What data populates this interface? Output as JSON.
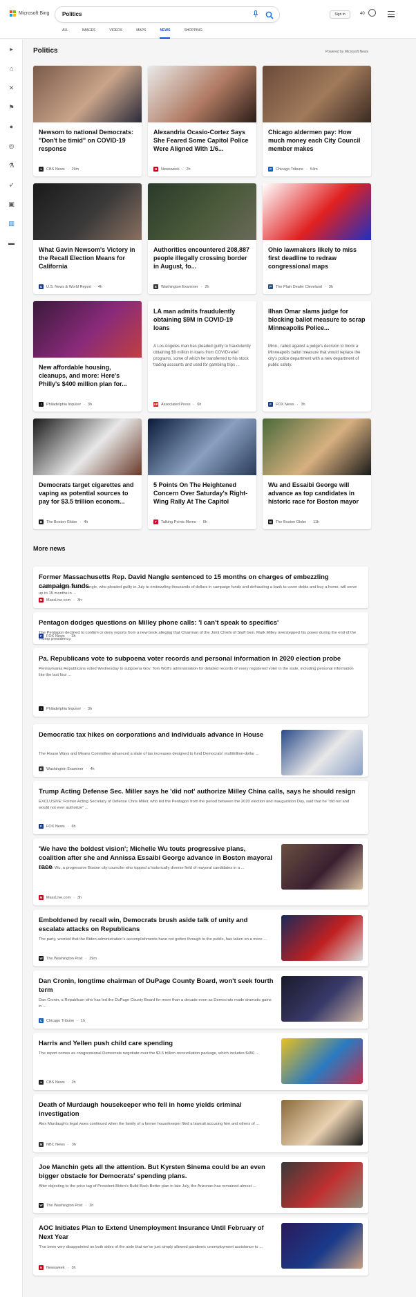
{
  "header": {
    "logo_text": "Microsoft Bing",
    "search_query": "Politics",
    "tabs": [
      "ALL",
      "IMAGES",
      "VIDEOS",
      "MAPS",
      "NEWS",
      "SHOPPING"
    ],
    "active_tab": "NEWS",
    "signin_label": "Sign in",
    "reward_points": "40"
  },
  "rail": {
    "items": [
      "expand-icon",
      "home-icon",
      "tools-icon",
      "flag-icon",
      "location-icon",
      "globe-icon",
      "science-icon",
      "rocket-icon",
      "media-icon",
      "building-icon",
      "card-icon"
    ]
  },
  "section": {
    "title": "Politics",
    "powered_by": "Powered by Microsoft News"
  },
  "cards": [
    {
      "title": "Newsom to national Democrats: \"Don't be timid\" on COVID-19 response",
      "source": "CBS News",
      "time": "29m",
      "logo": "●",
      "logo_color": "#222222",
      "image_colors": [
        "#7a5a4a",
        "#c9a48a",
        "#2b2b3a"
      ]
    },
    {
      "title": "Alexandria Ocasio-Cortez Says She Feared Some Capitol Police Were Aligned With 1/6...",
      "source": "Newsweek",
      "time": "2h",
      "logo": "N",
      "logo_color": "#d0021b",
      "image_colors": [
        "#e9e9e9",
        "#b07a62",
        "#2a1d18"
      ]
    },
    {
      "title": "Chicago aldermen pay: How much money each City Council member makes",
      "source": "Chicago Tribune",
      "time": "54m",
      "logo": "C",
      "logo_color": "#1a5fb4",
      "image_colors": [
        "#6b4a3a",
        "#a07a5a",
        "#3a2a22"
      ]
    },
    {
      "title": "What Gavin Newsom's Victory in the Recall Election Means for California",
      "source": "U.S. News & World Report",
      "time": "4h",
      "logo": "U",
      "logo_color": "#1c3d8f",
      "image_colors": [
        "#1a1a1a",
        "#3a3a3a",
        "#8a7060"
      ]
    },
    {
      "title": "Authorities encountered 208,887 people illegally crossing border in August, fo...",
      "source": "Washington Examiner",
      "time": "2h",
      "logo": "E",
      "logo_color": "#333333",
      "image_colors": [
        "#2a3a2a",
        "#4a5a3a",
        "#6a6a5a"
      ]
    },
    {
      "title": "Ohio lawmakers likely to miss first deadline to redraw congressional maps",
      "source": "The Plain Dealer Cleveland",
      "time": "3h",
      "logo": "P",
      "logo_color": "#2b4c7e",
      "image_colors": [
        "#ffffff",
        "#e02020",
        "#2030c0"
      ]
    },
    {
      "title": "New affordable housing, cleanups, and more: Here's Philly's $400 million plan for...",
      "source": "Philadelphia Inquirer",
      "time": "3h",
      "logo": "I",
      "logo_color": "#111111",
      "image_colors": [
        "#3a1a3a",
        "#8a2a7a",
        "#c04040"
      ]
    },
    {
      "title": "LA man admits fraudulently obtaining $9M in COVID-19 loans",
      "snippet": "A Los Angeles man has pleaded guilty to fraudulently obtaining $9 million in loans from COVID-relief programs, some of which he transferred to his stock trading accounts and used for gambling trips ...",
      "source": "Associated Press",
      "time": "6h",
      "logo": "AP",
      "logo_color": "#e2231a"
    },
    {
      "title": "Ilhan Omar slams judge for blocking ballot measure to scrap Minneapolis Police...",
      "snippet": "Minn., railed against a judge's decision to block a Minneapolis ballot measure that would replace the city's police department with a new department of public safety.",
      "source": "FOX News",
      "time": "3h",
      "logo": "F",
      "logo_color": "#1a3a8a"
    },
    {
      "title": "Democrats target cigarettes and vaping as potential sources to pay for $3.5 trillion econom...",
      "source": "The Boston Globe",
      "time": "4h",
      "logo": "B",
      "logo_color": "#222222",
      "image_colors": [
        "#1a1a1a",
        "#e8e8e8",
        "#6a3a2a"
      ]
    },
    {
      "title": "5 Points On The Heightened Concern Over Saturday's Right-Wing Rally At The Capitol",
      "source": "Talking Points Memo",
      "time": "6h",
      "logo": "T",
      "logo_color": "#c8102e",
      "image_colors": [
        "#0a1a3a",
        "#8aa0c0",
        "#2a3a5a"
      ]
    },
    {
      "title": "Wu and Essaibi George will advance as top candidates in historic race for Boston mayor",
      "source": "The Boston Globe",
      "time": "11h",
      "logo": "B",
      "logo_color": "#222222",
      "image_colors": [
        "#4a6a3a",
        "#d8b080",
        "#1a1a1a"
      ]
    }
  ],
  "more_news": {
    "title": "More news",
    "items": [
      {
        "title": "Former Massachusetts Rep. David Nangle sentenced to 15 months on charges of embezzling campaign funds",
        "snippet": "Former State Rep. David Nangle, who pleaded guilty in July to embezzling thousands of dollars in campaign funds and defrauding a bank to cover debts and buy a home, will serve up to 15 months in ...",
        "source": "MassLive.com",
        "time": "3h",
        "logo": "M",
        "logo_color": "#d0021b"
      },
      {
        "title": "Pentagon dodges questions on Milley phone calls: 'I can't speak to specifics'",
        "snippet": "The Pentagon declined to confirm or deny reports from a new book alleging that Chairman of the Joint Chiefs of Staff Gen. Mark Milley overstepped his power during the end of the Trump presidency.",
        "source": "FOX News",
        "time": "3h",
        "logo": "F",
        "logo_color": "#1a3a8a"
      },
      {
        "title": "Pa. Republicans vote to subpoena voter records and personal information in 2020 election probe",
        "snippet": "Pennsylvania Republicans voted Wednesday to subpoena Gov. Tom Wolf's administration for detailed records of every registered voter in the state, including personal information like the last four ...",
        "source": "Philadelphia Inquirer",
        "time": "3h",
        "logo": "I",
        "logo_color": "#111111"
      },
      {
        "title": "Democratic tax hikes on corporations and individuals advance in House",
        "snippet": "The House Ways and Means Committee advanced a slate of tax increases designed to fund Democrats' multitrillion-dollar ...",
        "source": "Washington Examiner",
        "time": "4h",
        "logo": "E",
        "logo_color": "#333333",
        "image_colors": [
          "#2a4a8a",
          "#e8e8e8",
          "#8aa0c8"
        ]
      },
      {
        "title": "Trump Acting Defense Sec. Miller says he 'did not' authorize Milley China calls, says he should resign",
        "snippet": "EXCLUSIVE: Former Acting Secretary of Defense Chris Miller, who led the Pentagon from the period between the 2020 election and inauguration Day, said that he \"did not and would not ever authorize\" ...",
        "source": "FOX News",
        "time": "6h",
        "logo": "F",
        "logo_color": "#1a3a8a"
      },
      {
        "title": "'We have the boldest vision'; Michelle Wu touts progressive plans, coalition after she and Annissa Essaibi George advance in Boston mayoral race",
        "snippet": "Michelle Wu, a progressive Boston city councilor who topped a historically diverse field of mayoral candidates in a ...",
        "source": "MassLive.com",
        "time": "3h",
        "logo": "M",
        "logo_color": "#d0021b",
        "image_colors": [
          "#6a5040",
          "#3a2030",
          "#d8c0a0"
        ]
      },
      {
        "title": "Emboldened by recall win, Democrats brush aside talk of unity and escalate attacks on Republicans",
        "snippet": "The party, worried that the Biden administration's accomplishments have not gotten through to the public, has taken on a more ...",
        "source": "The Washington Post",
        "time": "29m",
        "logo": "W",
        "logo_color": "#111111",
        "image_colors": [
          "#1a2a5a",
          "#c02020",
          "#d8d8d8"
        ]
      },
      {
        "title": "Dan Cronin, longtime chairman of DuPage County Board, won't seek fourth term",
        "snippet": "Dan Cronin, a Republican who has led the DuPage County Board for more than a decade even as Democrats made dramatic gains in ...",
        "source": "Chicago Tribune",
        "time": "1h",
        "logo": "C",
        "logo_color": "#1a5fb4",
        "image_colors": [
          "#1a1a2a",
          "#3a3a6a",
          "#c8b0a0"
        ]
      },
      {
        "title": "Harris and Yellen push child care spending",
        "snippet": "The report comes as congressional Democrats negotiate over the $3.5 trillion reconciliation package, which includes $450 ...",
        "source": "CBS News",
        "time": "2h",
        "logo": "●",
        "logo_color": "#222222",
        "image_colors": [
          "#e8c020",
          "#2a7ac0",
          "#c03050"
        ]
      },
      {
        "title": "Death of Murdaugh housekeeper who fell in home yields criminal investigation",
        "snippet": "Alex Murdaugh's legal woes continued when the family of a former housekeeper filed a lawsuit accusing him and others of ...",
        "source": "NBC News",
        "time": "3h",
        "logo": "N",
        "logo_color": "#333333",
        "image_colors": [
          "#8a6a3a",
          "#e8d0b0",
          "#1a1a1a"
        ]
      },
      {
        "title": "Joe Manchin gets all the attention. But Kyrsten Sinema could be an even bigger obstacle for Democrats' spending plans.",
        "snippet": "After objecting to the price tag of President Biden's Build Back Better plan in late July, the Arizonan has remained almost ...",
        "source": "The Washington Post",
        "time": "2h",
        "logo": "W",
        "logo_color": "#111111",
        "image_colors": [
          "#3a3a3a",
          "#c03030",
          "#8a8a7a"
        ]
      },
      {
        "title": "AOC Initiates Plan to Extend Unemployment Insurance Until February of Next Year",
        "snippet": "\"I've been very disappointed on both sides of the aisle that we've just simply allowed pandemic unemployment assistance to ...",
        "source": "Newsweek",
        "time": "3h",
        "logo": "N",
        "logo_color": "#d0021b",
        "image_colors": [
          "#2a1a5a",
          "#1a3a8a",
          "#c8a080"
        ]
      }
    ]
  }
}
